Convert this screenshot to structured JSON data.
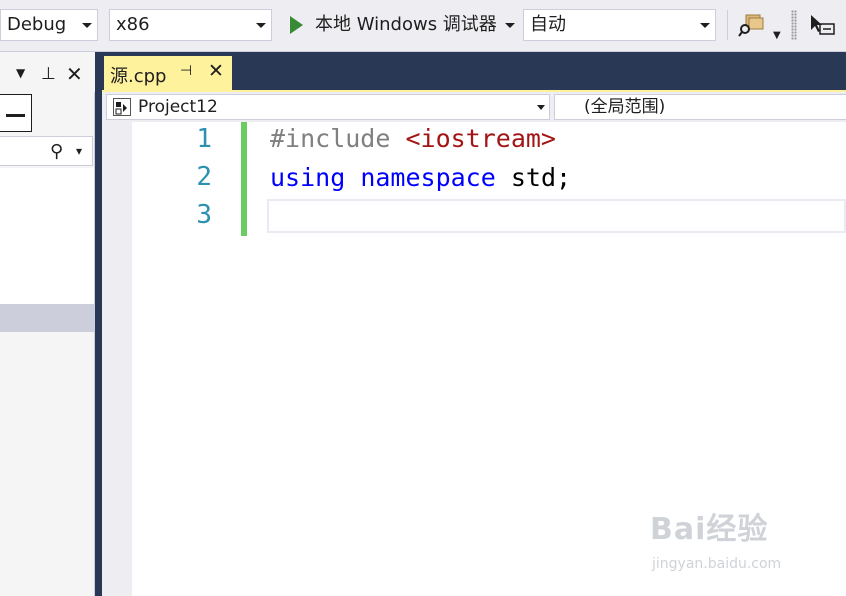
{
  "toolbar": {
    "config": "Debug",
    "platform": "x86",
    "run_label": "本地 Windows 调试器",
    "mode": "自动"
  },
  "tab": {
    "filename": "源.cpp"
  },
  "navbar": {
    "project": "Project12",
    "scope": "(全局范围)"
  },
  "editor": {
    "line_numbers": [
      "1",
      "2",
      "3"
    ],
    "lines": [
      [
        {
          "t": "pp",
          "v": "#include "
        },
        {
          "t": "str",
          "v": "<iostream>"
        }
      ],
      [
        {
          "t": "kw",
          "v": "using"
        },
        {
          "t": "n",
          "v": " "
        },
        {
          "t": "kw",
          "v": "namespace"
        },
        {
          "t": "n",
          "v": " std;"
        }
      ],
      []
    ]
  },
  "watermark": {
    "brand": "Bai经验",
    "url": "jingyan.baidu.com"
  }
}
